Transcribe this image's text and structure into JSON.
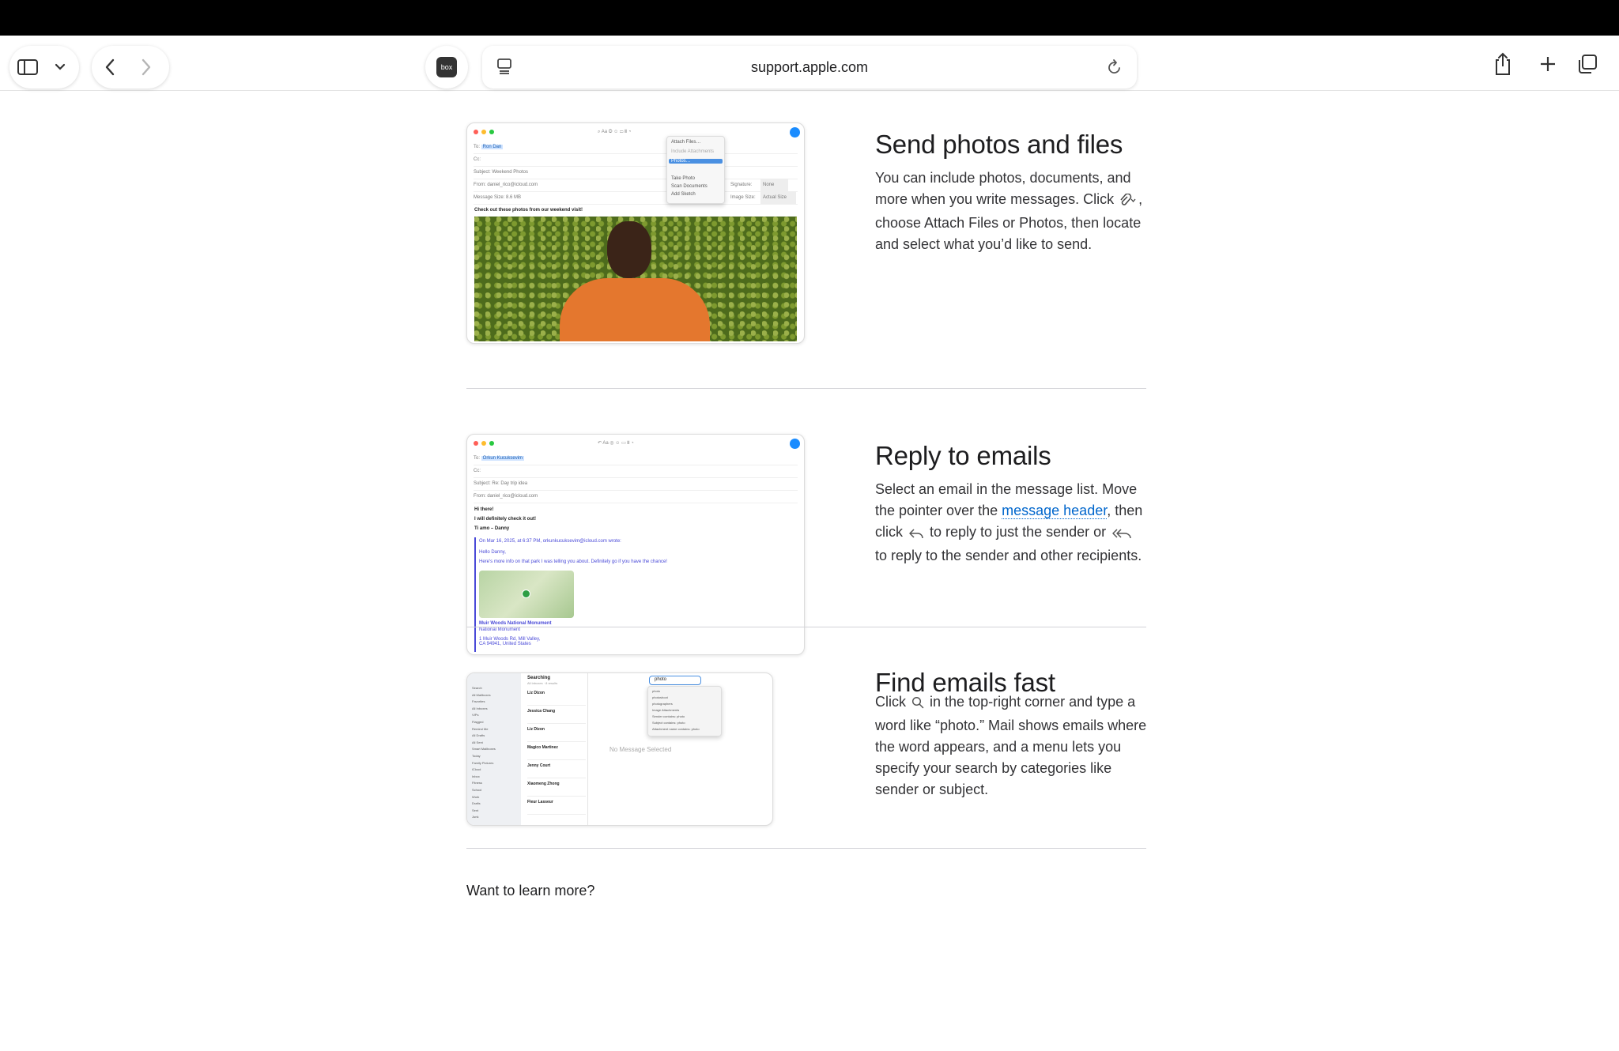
{
  "browser": {
    "url": "support.apple.com",
    "extension_label": "box"
  },
  "sections": [
    {
      "heading": "Send photos and files",
      "body_before": "You can include photos, documents, and more when you write messages. Click",
      "body_after": ", choose Attach Files or Photos, then locate and select what you’d like to send.",
      "screenshot": {
        "to": "Ron Dan",
        "subject": "Weekend Photos",
        "from": "daniel_rico@icloud.com",
        "message_size": "Message Size: 8.6 MB",
        "signature_label": "Signature:",
        "signature_value": "None",
        "image_size_label": "Image Size:",
        "image_size_value": "Actual Size",
        "body": "Check out these photos from our weekend visit!",
        "menu": [
          "Attach Files…",
          "Include Attachments",
          "Photos…",
          "Take Photo",
          "Scan Documents",
          "Add Sketch"
        ]
      }
    },
    {
      "heading": "Reply to emails",
      "body_1": "Select an email in the message list. Move the pointer over the",
      "link": "message header",
      "body_2": ", then click",
      "body_3": "to reply to just the sender or",
      "body_4": "to reply to the sender and other recipients.",
      "screenshot": {
        "to": "Orkun Kucuksevim",
        "subject": "Re: Day trip idea",
        "from": "daniel_rico@icloud.com",
        "greeting": "Hi there!",
        "line": "I will definitely check it out!",
        "sign": "Ti amo – Danny",
        "quote_header": "On Mar 16, 2025, at 6:37 PM, orkunkucuksevim@icloud.com wrote:",
        "quote_1": "Hello Danny,",
        "quote_2": "Here's more info on that park I was telling you about. Definitely go if you have the chance!",
        "map_title": "Muir Woods National Monument",
        "map_sub": "National Monument",
        "address": "1 Muir Woods Rd, Mill Valley, CA 94941, United States"
      }
    },
    {
      "heading": "Find emails fast",
      "body_1": "Click",
      "body_2": "in the top-right corner and type a word like “photo.” Mail shows emails where the word appears, and a menu lets you specify your search by categories like sender or subject.",
      "screenshot": {
        "list_title": "Searching",
        "list_sub": "All Inboxes · 8 results",
        "search_value": "photo",
        "no_selection": "No Message Selected",
        "sidebar": [
          "Search",
          "All Mailboxes",
          "Favorites",
          "All Inboxes",
          "VIPs",
          "Flagged",
          "Remind Me",
          "All Drafts",
          "All Sent",
          "Smart Mailboxes",
          "Today",
          "Family Pictures",
          "iCloud",
          "Inbox",
          "Fitness",
          "School",
          "Work",
          "Drafts",
          "Sent",
          "Junk"
        ],
        "senders": [
          "Liz Dizon",
          "Jessica Chang",
          "Liz Dizon",
          "Magico Martinez",
          "Jenny Court",
          "Xiaomeng Zhong",
          "Fleur Lasseur"
        ],
        "suggestions": [
          "photo",
          "photoshoot",
          "photographers",
          "Image Attachments",
          "Sender contains: photo",
          "Subject contains: photo",
          "Attachment name contains: photo"
        ]
      }
    }
  ],
  "footer": {
    "learn_more": "Want to learn more?"
  },
  "colors": {
    "link": "#0066cc",
    "text": "#1d1d1f",
    "accent_blue": "#1a8cff"
  }
}
